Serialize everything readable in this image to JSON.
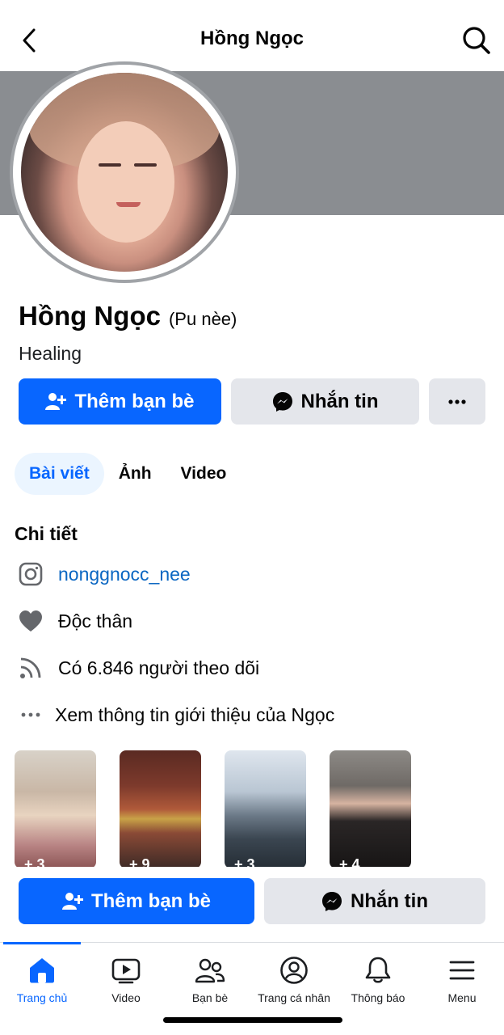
{
  "header": {
    "title": "Hồng Ngọc"
  },
  "profile": {
    "name": "Hồng Ngọc",
    "alt_name": "(Pu nèe)",
    "bio": "Healing"
  },
  "actions": {
    "add_friend": "Thêm bạn bè",
    "message": "Nhắn tin"
  },
  "tabs": [
    {
      "label": "Bài viết"
    },
    {
      "label": "Ảnh"
    },
    {
      "label": "Video"
    }
  ],
  "details": {
    "title": "Chi tiết",
    "instagram": "nonggnocc_nee",
    "relationship": "Độc thân",
    "followers": "Có 6.846 người theo dõi",
    "about": "Xem thông tin giới thiệu của Ngọc"
  },
  "photos": [
    {
      "count": "+ 3"
    },
    {
      "count": "+ 9"
    },
    {
      "count": "+ 3"
    },
    {
      "count": "+ 4"
    }
  ],
  "nav": [
    {
      "label": "Trang chủ"
    },
    {
      "label": "Video"
    },
    {
      "label": "Bạn bè"
    },
    {
      "label": "Trang cá nhân"
    },
    {
      "label": "Thông báo"
    },
    {
      "label": "Menu"
    }
  ],
  "colors": {
    "accent": "#0866ff",
    "secondary_button": "#e4e6eb",
    "cover": "#8a8d91",
    "link": "#0a66c2"
  }
}
